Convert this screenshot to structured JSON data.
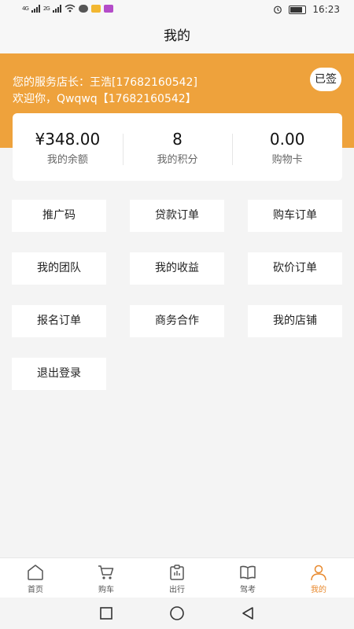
{
  "status_bar": {
    "signal_left": "4G",
    "signal_right": "2G",
    "time": "16:23",
    "icons": [
      "signal-icon",
      "wifi-icon",
      "message-icon",
      "app-notification-icon",
      "alarm-icon",
      "battery-icon"
    ]
  },
  "header": {
    "title": "我的"
  },
  "profile": {
    "store_manager": "您的服务店长：王浩[17682160542]",
    "welcome": "欢迎你，Qwqwq【17682160542】",
    "sign_status": "已签"
  },
  "stats": [
    {
      "value": "¥348.00",
      "label": "我的余额"
    },
    {
      "value": "8",
      "label": "我的积分"
    },
    {
      "value": "0.00",
      "label": "购物卡"
    }
  ],
  "menu": [
    {
      "label": "推广码"
    },
    {
      "label": "贷款订单"
    },
    {
      "label": "购车订单"
    },
    {
      "label": "我的团队"
    },
    {
      "label": "我的收益"
    },
    {
      "label": "砍价订单"
    },
    {
      "label": "报名订单"
    },
    {
      "label": "商务合作"
    },
    {
      "label": "我的店铺"
    },
    {
      "label": "退出登录"
    }
  ],
  "tabbar": [
    {
      "label": "首页",
      "icon": "home-icon"
    },
    {
      "label": "购车",
      "icon": "cart-icon"
    },
    {
      "label": "出行",
      "icon": "clipboard-icon"
    },
    {
      "label": "驾考",
      "icon": "book-icon"
    },
    {
      "label": "我的",
      "icon": "user-icon",
      "active": true
    }
  ],
  "colors": {
    "accent": "#eea23c",
    "active_tab": "#e8892d",
    "background": "#f4f4f4"
  }
}
